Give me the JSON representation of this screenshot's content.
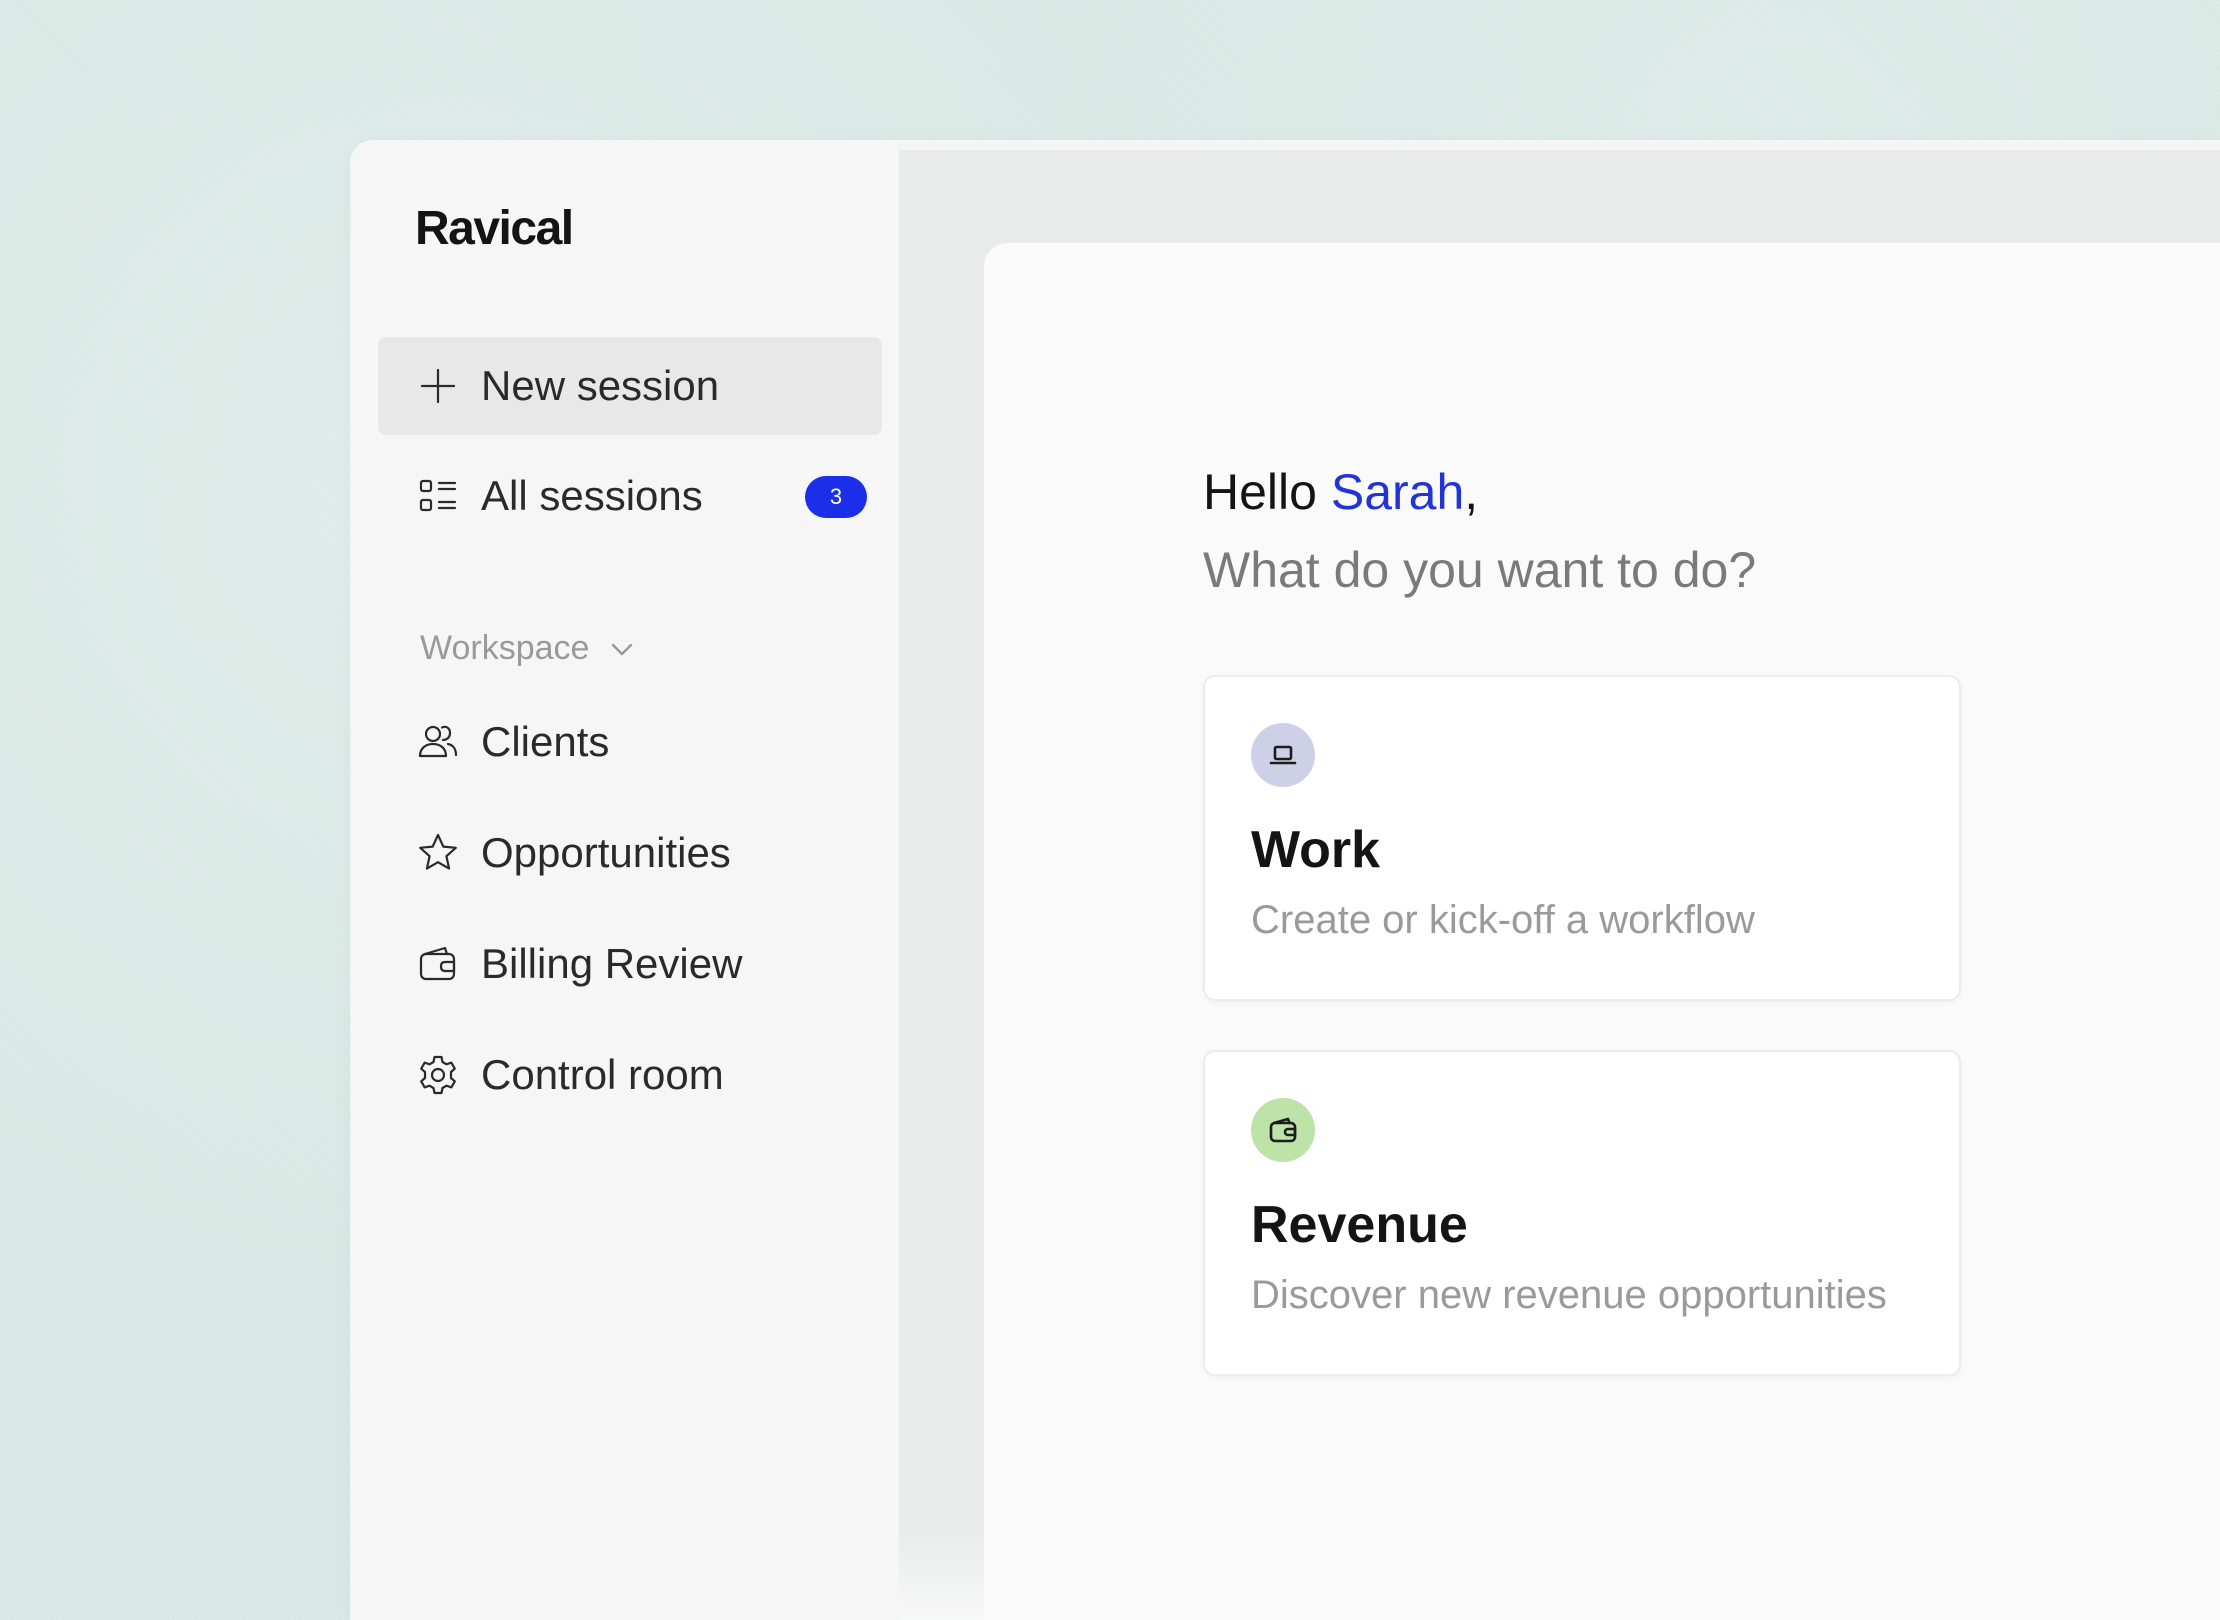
{
  "app": {
    "brand": "Ravical"
  },
  "sidebar": {
    "new_session": {
      "label": "New session",
      "icon": "plus-icon"
    },
    "all_sessions": {
      "label": "All sessions",
      "icon": "list-icon",
      "badge_count": "3"
    },
    "workspace_label": "Workspace",
    "workspace_icon": "chevron-down-icon",
    "items": [
      {
        "label": "Clients",
        "icon": "users-icon"
      },
      {
        "label": "Opportunities",
        "icon": "star-icon"
      },
      {
        "label": "Billing Review",
        "icon": "wallet-icon"
      },
      {
        "label": "Control room",
        "icon": "gear-icon"
      }
    ]
  },
  "main": {
    "greeting_prefix": "Hello ",
    "user_name": "Sarah",
    "greeting_suffix": ",",
    "subheading": "What do you want to do?",
    "cards": [
      {
        "title": "Work",
        "description": "Create or kick-off a workflow",
        "icon": "laptop-icon",
        "icon_bg": "#cdd0e6"
      },
      {
        "title": "Revenue",
        "description": "Discover new revenue opportunities",
        "icon": "wallet-icon",
        "icon_bg": "#bde3a8"
      }
    ]
  },
  "colors": {
    "accent": "#2233d8",
    "badge": "#1b2ee8",
    "background": "#dbeae6"
  }
}
